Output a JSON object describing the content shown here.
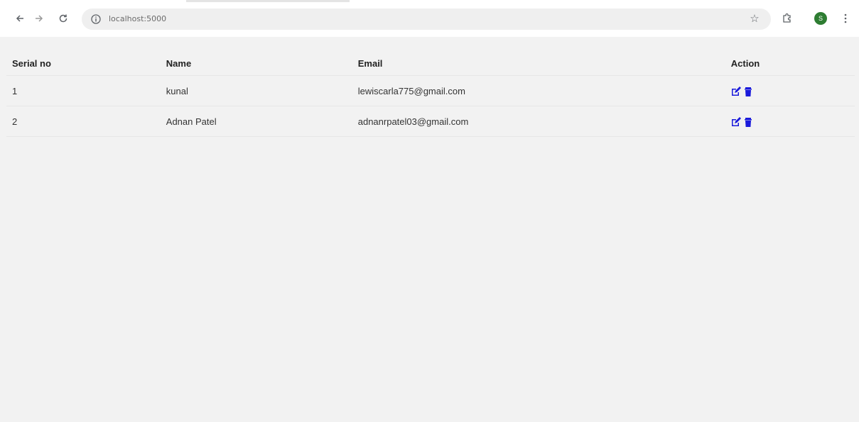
{
  "browser": {
    "url": "localhost:5000",
    "back_icon": "arrow-left-icon",
    "forward_icon": "arrow-right-icon",
    "reload_icon": "reload-icon",
    "avatar_initial": "S",
    "accent_color": "#2e7d32"
  },
  "table": {
    "headers": {
      "serial": "Serial no",
      "name": "Name",
      "email": "Email",
      "action": "Action"
    },
    "rows": [
      {
        "serial": "1",
        "name": "kunal",
        "email": "lewiscarla775@gmail.com"
      },
      {
        "serial": "2",
        "name": "Adnan Patel",
        "email": "adnanrpatel03@gmail.com"
      }
    ],
    "action_icons": [
      "edit-icon",
      "delete-icon"
    ],
    "action_color": "#1a1adb"
  }
}
